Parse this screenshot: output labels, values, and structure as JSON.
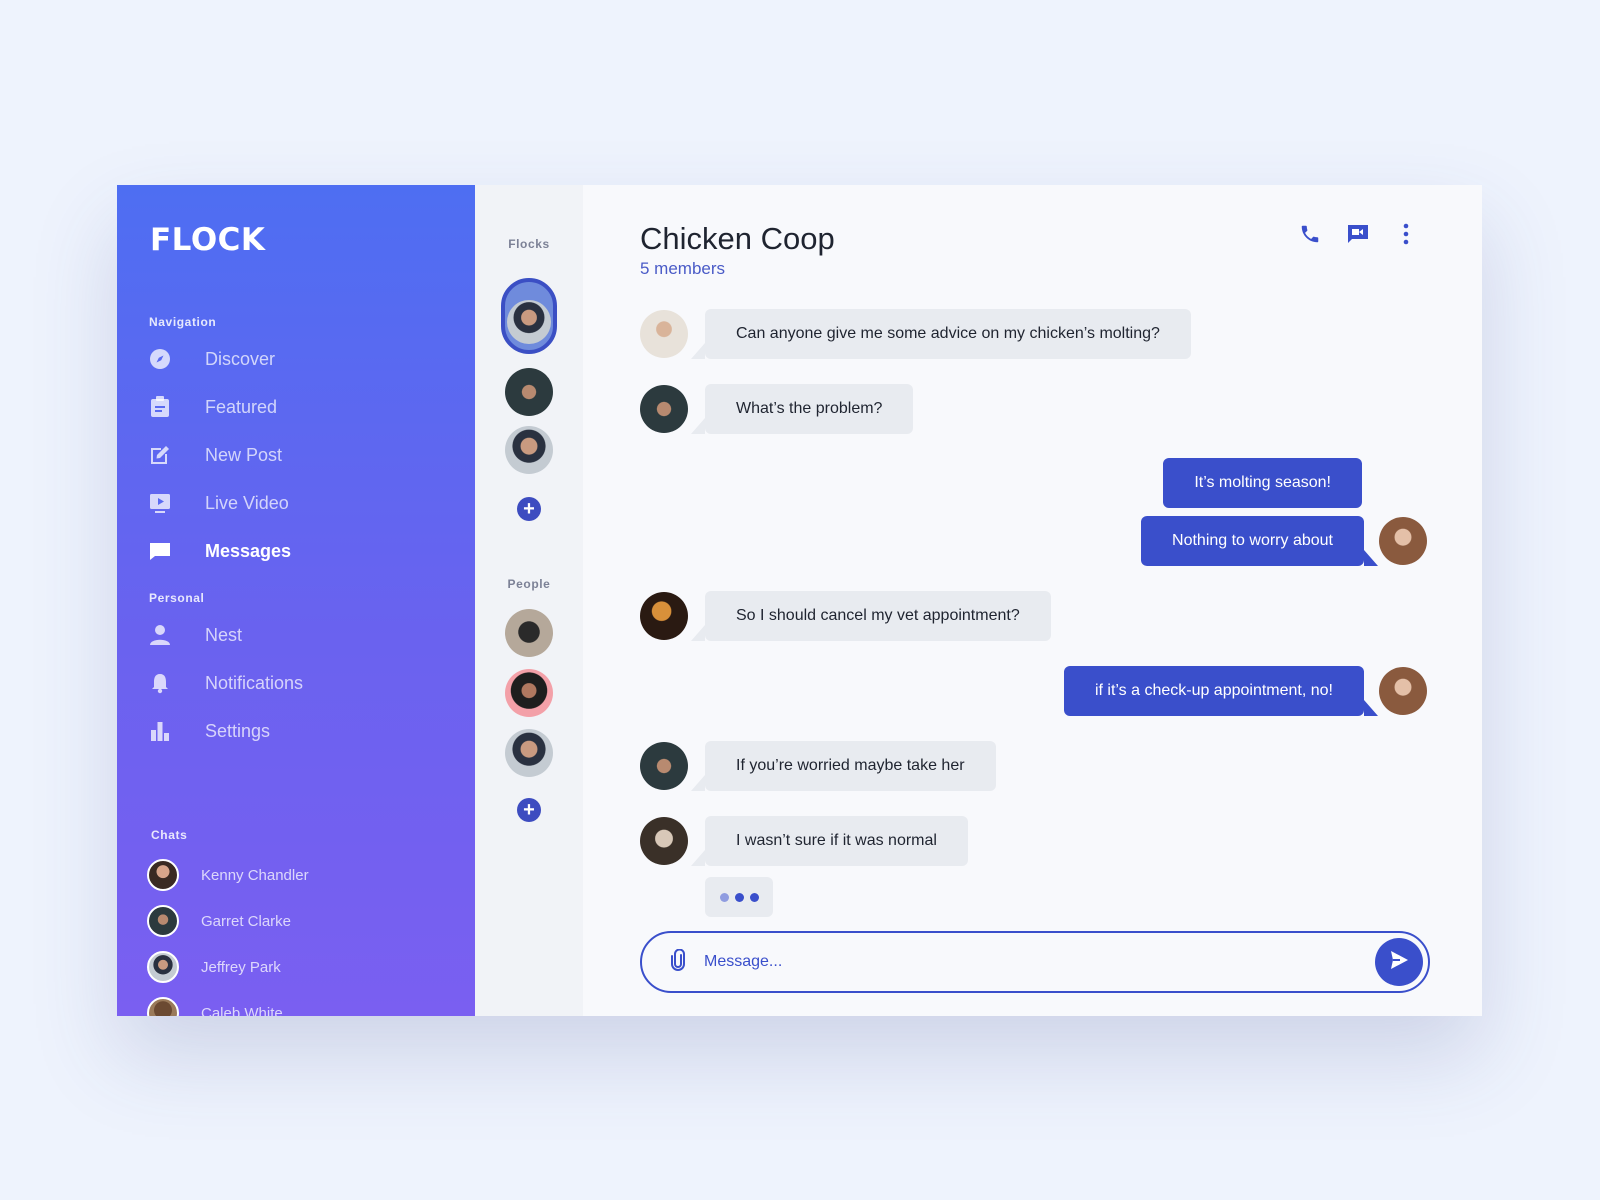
{
  "brand": "FLOCK",
  "sidebar": {
    "navigation_label": "Navigation",
    "nav_items": [
      {
        "label": "Discover",
        "icon": "compass-icon"
      },
      {
        "label": "Featured",
        "icon": "clipboard-icon"
      },
      {
        "label": "New Post",
        "icon": "edit-icon"
      },
      {
        "label": "Live Video",
        "icon": "video-play-icon"
      },
      {
        "label": "Messages",
        "icon": "message-icon",
        "active": true
      }
    ],
    "personal_label": "Personal",
    "personal_items": [
      {
        "label": "Nest",
        "icon": "person-icon"
      },
      {
        "label": "Notifications",
        "icon": "bell-icon"
      },
      {
        "label": "Settings",
        "icon": "bar-chart-icon"
      }
    ],
    "chats_label": "Chats",
    "chats": [
      {
        "name": "Kenny Chandler"
      },
      {
        "name": "Garret Clarke"
      },
      {
        "name": "Jeffrey Park"
      },
      {
        "name": "Caleb White"
      }
    ]
  },
  "middle": {
    "flocks_label": "Flocks",
    "people_label": "People"
  },
  "conversation": {
    "title": "Chicken Coop",
    "members": "5 members",
    "messages": [
      {
        "text": "Can anyone give me some advice on my chicken’s molting?",
        "direction": "in"
      },
      {
        "text": "What’s the problem?",
        "direction": "in"
      },
      {
        "text": "It’s molting season!",
        "direction": "out"
      },
      {
        "text": "Nothing to worry about",
        "direction": "out"
      },
      {
        "text": "So I should cancel my vet appointment?",
        "direction": "in"
      },
      {
        "text": "if it’s a check-up appointment, no!",
        "direction": "out"
      },
      {
        "text": "If you’re worried maybe take her",
        "direction": "in"
      },
      {
        "text": "I wasn’t sure if it was normal",
        "direction": "in"
      }
    ],
    "composer_placeholder": "Message..."
  },
  "colors": {
    "accent": "#3a4fcb",
    "sidebar_top": "#4e6ef2",
    "sidebar_bottom": "#7a5ff1",
    "bubble_in": "#e8ebf0",
    "page_bg": "#eef3fd"
  }
}
